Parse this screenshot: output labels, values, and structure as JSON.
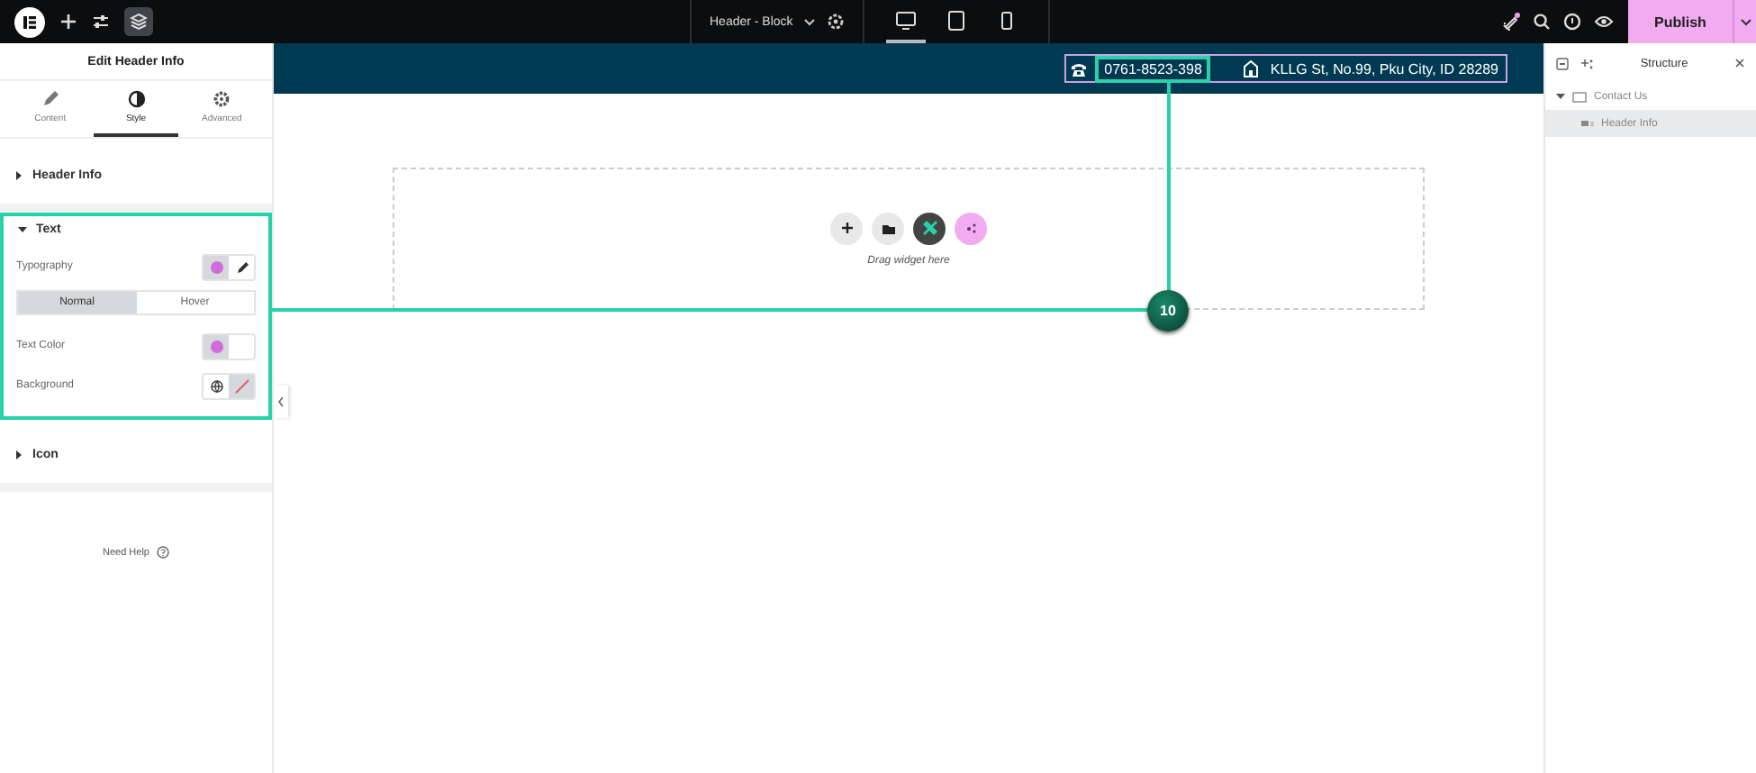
{
  "topbar": {
    "document_title": "Header - Block",
    "devices": [
      {
        "kind": "desktop",
        "selected": true
      },
      {
        "kind": "tablet",
        "selected": false
      },
      {
        "kind": "mobile",
        "selected": false
      }
    ],
    "notification": true,
    "publish_button": "Publish"
  },
  "left_panel": {
    "title": "Edit Header Info",
    "tabs": [
      {
        "kind": "content",
        "label": "Content",
        "selected": false
      },
      {
        "kind": "style",
        "label": "Style",
        "selected": true
      },
      {
        "kind": "advanced",
        "label": "Advanced",
        "selected": false
      }
    ],
    "sections": [
      {
        "title": "Header Info",
        "expanded": false,
        "highlighted": false
      },
      {
        "title": "Text",
        "expanded": true,
        "highlighted": true,
        "controls": [
          {
            "kind": "typography",
            "label": "Typography",
            "color": "#d36bdc"
          },
          {
            "kind": "states",
            "options": [
              {
                "label": "Normal",
                "selected": true
              },
              {
                "label": "Hover",
                "selected": false
              }
            ]
          },
          {
            "kind": "color",
            "label": "Text Color",
            "color": "#d36bdc"
          },
          {
            "kind": "background",
            "label": "Background"
          }
        ]
      },
      {
        "title": "Icon",
        "expanded": false,
        "highlighted": false
      }
    ],
    "help": "Need Help"
  },
  "canvas": {
    "header_items": [
      {
        "kind": "phone",
        "text": "0761-8523-398",
        "highlighted": true
      },
      {
        "kind": "address",
        "text": "KLLG St, No.99, Pku City, ID 28289",
        "highlighted": false
      }
    ],
    "drop_hint": "Drag widget here",
    "annotation_badge": "10"
  },
  "structure": {
    "title": "Structure",
    "tree": [
      {
        "label": "Contact Us",
        "expanded": true,
        "selected": false,
        "children": [
          {
            "label": "Header Info",
            "selected": true
          }
        ]
      }
    ]
  }
}
